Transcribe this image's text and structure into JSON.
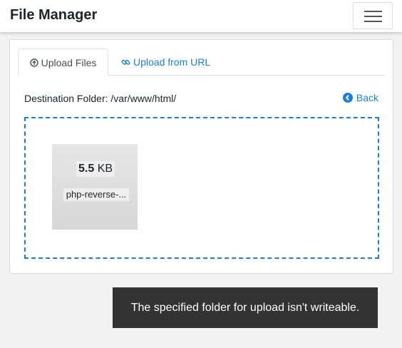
{
  "app": {
    "title": "File Manager"
  },
  "tabs": [
    {
      "label": "Upload Files",
      "icon": "upload-circle-icon",
      "active": true
    },
    {
      "label": "Upload from URL",
      "icon": "link-icon",
      "active": false
    }
  ],
  "destination": {
    "text": "Destination Folder: /var/www/html/"
  },
  "back": {
    "label": "Back",
    "icon": "back-circle-icon"
  },
  "file": {
    "size_value": "5.5",
    "size_unit": "KB",
    "name": "php-reverse-..."
  },
  "toast": {
    "message": "The specified folder for upload isn't writeable."
  },
  "colors": {
    "accent": "#1a7fd9",
    "toast_bg": "#333333"
  }
}
